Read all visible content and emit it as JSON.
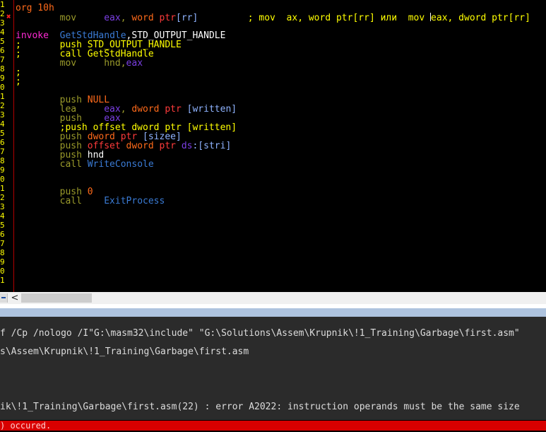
{
  "colors": {
    "line_number": "#ffff00",
    "error_marker": "#ff2020",
    "directive": "#ff6a1a",
    "keyword": "#ff2ad4",
    "identifier": "#3a7bd5",
    "register": "#7b3fe4",
    "ptr_keyword": "#ff3b3b",
    "bracket": "#8fb3ff",
    "instruction_dim": "#9a9a2a",
    "instruction": "#ffff00",
    "plain": "#ffffff",
    "comment": "#ffff00",
    "status_bar": "#d80000",
    "output_bg": "#2b2b2b",
    "output_text": "#dcdcdc",
    "splitter": "#aec3de"
  },
  "editor": {
    "line_numbers": [
      "1",
      "2",
      "3",
      "4",
      "5",
      "6",
      "7",
      "8",
      "9",
      "0",
      "1",
      "2",
      "3",
      "4",
      "5",
      "6",
      "7",
      "8",
      "9",
      "0",
      "1",
      "2",
      "3",
      "4",
      "5",
      "6",
      "7",
      "8",
      "9",
      "0",
      "1"
    ],
    "error_marker": "✖",
    "lines": [
      [
        {
          "t": "org 10h",
          "c": "#ff6a1a"
        }
      ],
      [
        {
          "t": "        mov     ",
          "c": "#9a9a2a"
        },
        {
          "t": "eax",
          "c": "#7b3fe4"
        },
        {
          "t": ", ",
          "c": "#9a9a2a"
        },
        {
          "t": "word ",
          "c": "#ff6a1a"
        },
        {
          "t": "ptr",
          "c": "#ff3b3b"
        },
        {
          "t": "[rr]",
          "c": "#8fb3ff"
        },
        {
          "t": "         ; mov  ax, word ptr[rr] или  mov ",
          "c": "#ffff00"
        },
        {
          "cursor": true
        },
        {
          "t": "eax, dword ptr[rr]",
          "c": "#ffff00"
        }
      ],
      [],
      [
        {
          "t": "invoke",
          "c": "#ff2ad4"
        },
        {
          "t": "  ",
          "c": "#ffffff"
        },
        {
          "t": "GetStdHandle",
          "c": "#3a7bd5"
        },
        {
          "t": ",STD_OUTPUT_HANDLE",
          "c": "#ffffff"
        }
      ],
      [
        {
          "t": ";       push STD_OUTPUT_HANDLE",
          "c": "#ffff00"
        }
      ],
      [
        {
          "t": ";       call GetStdHandle",
          "c": "#ffff00"
        }
      ],
      [
        {
          "t": "        mov     hnd,",
          "c": "#9a9a2a"
        },
        {
          "t": "eax",
          "c": "#7b3fe4"
        }
      ],
      [
        {
          "t": ";",
          "c": "#ffff00"
        }
      ],
      [
        {
          "t": ";",
          "c": "#ffff00"
        }
      ],
      [],
      [
        {
          "t": "        push ",
          "c": "#9a9a2a"
        },
        {
          "t": "NULL",
          "c": "#ff6a1a"
        }
      ],
      [
        {
          "t": "        lea     ",
          "c": "#9a9a2a"
        },
        {
          "t": "eax",
          "c": "#7b3fe4"
        },
        {
          "t": ", ",
          "c": "#9a9a2a"
        },
        {
          "t": "dword ",
          "c": "#ff6a1a"
        },
        {
          "t": "ptr ",
          "c": "#ff3b3b"
        },
        {
          "t": "[written]",
          "c": "#8fb3ff"
        }
      ],
      [
        {
          "t": "        push    ",
          "c": "#9a9a2a"
        },
        {
          "t": "eax",
          "c": "#7b3fe4"
        }
      ],
      [
        {
          "t": "        ;push offset dword ptr [written]",
          "c": "#ffff00"
        }
      ],
      [
        {
          "t": "        push ",
          "c": "#9a9a2a"
        },
        {
          "t": "dword ",
          "c": "#ff6a1a"
        },
        {
          "t": "ptr ",
          "c": "#ff3b3b"
        },
        {
          "t": "[sizee]",
          "c": "#8fb3ff"
        }
      ],
      [
        {
          "t": "        push ",
          "c": "#9a9a2a"
        },
        {
          "t": "offset ",
          "c": "#ff3b3b"
        },
        {
          "t": "dword ",
          "c": "#ff6a1a"
        },
        {
          "t": "ptr ",
          "c": "#ff3b3b"
        },
        {
          "t": "ds",
          "c": "#7b3fe4"
        },
        {
          "t": ":[stri]",
          "c": "#8fb3ff"
        }
      ],
      [
        {
          "t": "        push ",
          "c": "#9a9a2a"
        },
        {
          "t": "hnd",
          "c": "#ffffff"
        }
      ],
      [
        {
          "t": "        call ",
          "c": "#9a9a2a"
        },
        {
          "t": "WriteConsole",
          "c": "#3a7bd5"
        }
      ],
      [],
      [],
      [
        {
          "t": "        push ",
          "c": "#9a9a2a"
        },
        {
          "t": "0",
          "c": "#ff6a1a"
        }
      ],
      [
        {
          "t": "        call    ",
          "c": "#9a9a2a"
        },
        {
          "t": "ExitProcess",
          "c": "#3a7bd5"
        }
      ]
    ]
  },
  "hscroll": {
    "left_arrow": "<"
  },
  "output": {
    "lines": [
      {
        "row": 0,
        "text": "f /Cp /nologo /I\"G:\\masm32\\include\" \"G:\\Solutions\\Assem\\Krupnik\\!1_Training\\Garbage\\first.asm\""
      },
      {
        "row": 2,
        "text": "s\\Assem\\Krupnik\\!1_Training\\Garbage\\first.asm"
      },
      {
        "row": 8,
        "text": "ik\\!1_Training\\Garbage\\first.asm(22) : error A2022: instruction operands must be the same size"
      }
    ]
  },
  "status": {
    "text": ") occured."
  }
}
